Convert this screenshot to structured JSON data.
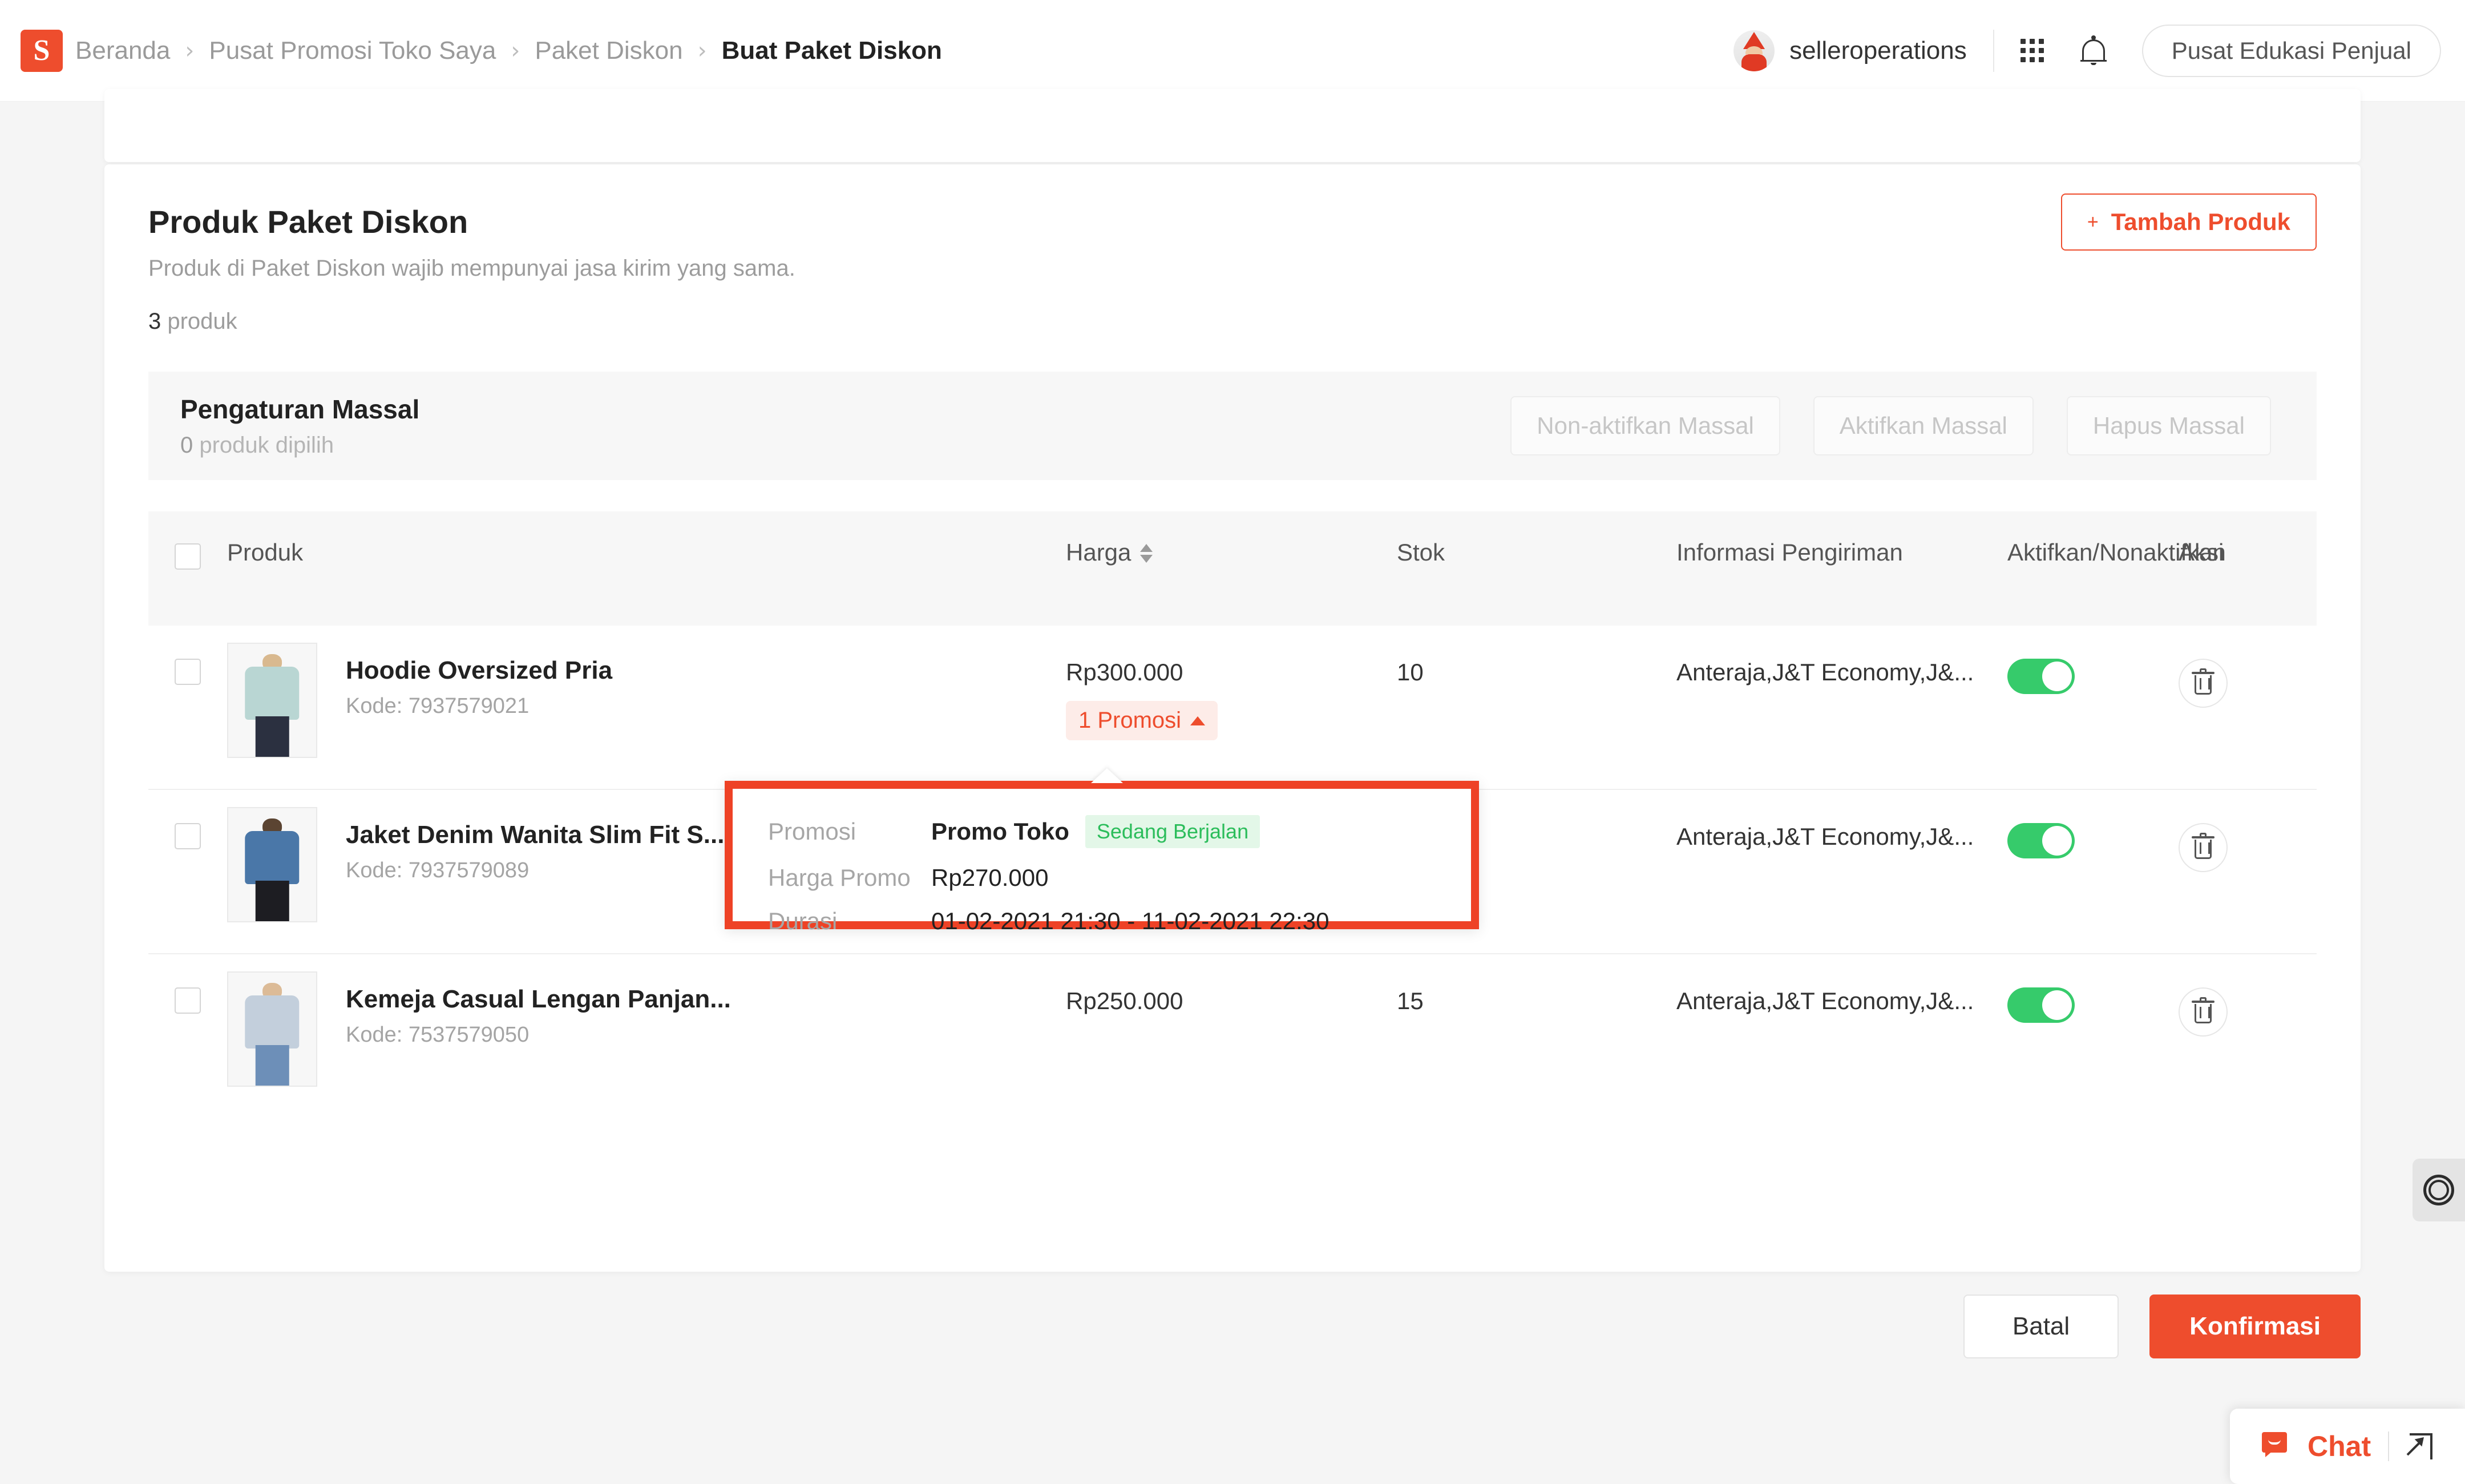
{
  "header": {
    "logo_icon": "shopee-bag-icon",
    "breadcrumb": [
      {
        "label": "Beranda",
        "current": false
      },
      {
        "label": "Pusat Promosi Toko Saya",
        "current": false
      },
      {
        "label": "Paket Diskon",
        "current": false
      },
      {
        "label": "Buat Paket Diskon",
        "current": true
      }
    ],
    "separator": "›",
    "username": "selleroperations",
    "grid_icon": "apps-grid-icon",
    "bell_icon": "notification-bell-icon",
    "edu_button": "Pusat Edukasi Penjual"
  },
  "card": {
    "title": "Produk Paket Diskon",
    "subtitle": "Produk di Paket Diskon wajib mempunyai jasa kirim yang sama.",
    "count_number": "3",
    "count_label": " produk",
    "add_button": "Tambah Produk",
    "add_button_icon": "plus-icon"
  },
  "bulk": {
    "title": "Pengaturan Massal",
    "selected_number": "0",
    "selected_label": " produk dipilih",
    "buttons": [
      "Non-aktifkan Massal",
      "Aktifkan Massal",
      "Hapus Massal"
    ]
  },
  "table": {
    "headers": {
      "produk": "Produk",
      "harga": "Harga",
      "stok": "Stok",
      "pengiriman": "Informasi Pengiriman",
      "aktifkan": "Aktifkan/Nonaktifkan",
      "aksi": "Aksi"
    },
    "rows": [
      {
        "name": "Hoodie Oversized Pria",
        "code": "Kode: 7937579021",
        "price": "Rp300.000",
        "promo_badge": "1 Promosi",
        "stock": "10",
        "shipping": "Anteraja,J&T Economy,J&...",
        "active": true,
        "thumb_class": "t1"
      },
      {
        "name": "Jaket Denim Wanita Slim Fit S...",
        "code": "Kode: 7937579089",
        "price": "",
        "promo_badge": "",
        "stock": "",
        "shipping": "Anteraja,J&T Economy,J&...",
        "active": true,
        "thumb_class": "t2"
      },
      {
        "name": "Kemeja Casual Lengan Panjan...",
        "code": "Kode: 7537579050",
        "price": "Rp250.000",
        "promo_badge": "",
        "stock": "15",
        "shipping": "Anteraja,J&T Economy,J&...",
        "active": true,
        "thumb_class": "t3"
      }
    ]
  },
  "promo_popover": {
    "rows": [
      {
        "label": "Promosi",
        "value": "Promo Toko",
        "badge": "Sedang Berjalan"
      },
      {
        "label": "Harga Promo",
        "value": "Rp270.000",
        "badge": ""
      },
      {
        "label": "Durasi",
        "value": "01-02-2021 21:30 - 11-02-2021 22:30",
        "badge": ""
      }
    ]
  },
  "footer": {
    "cancel": "Batal",
    "confirm": "Konfirmasi"
  },
  "floating": {
    "side_tab_icon": "loading-rings-icon",
    "chat_label": "Chat",
    "chat_icon": "chat-bubble-icon",
    "expand_icon": "expand-popout-icon"
  },
  "colors": {
    "brand": "#ee4d2d",
    "toggle_on": "#36cb6b",
    "status_green": "#2bbd5b",
    "annotation": "#ee4226"
  }
}
